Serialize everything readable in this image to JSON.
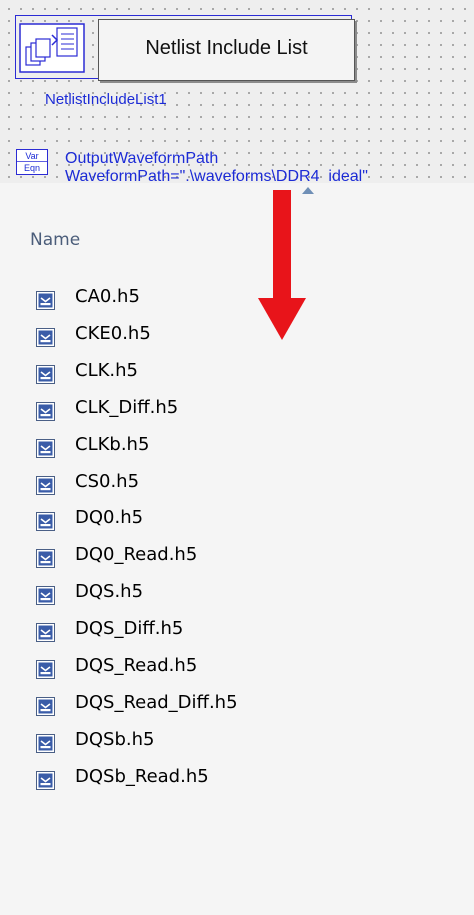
{
  "schematic": {
    "component": {
      "label": "Netlist Include List",
      "instance_name": "NetlistIncludeList1",
      "icon": "netlist-include-icon"
    },
    "var_eqn": {
      "icon_top": "Var",
      "icon_bottom": "Eqn",
      "name": "OutputWaveformPath",
      "expression": "WaveformPath=\".\\waveforms\\DDR4_ideal\""
    }
  },
  "annotation": {
    "arrow_color": "#e8141a",
    "icon": "down-arrow-icon"
  },
  "explorer": {
    "column_header": "Name",
    "sort_indicator_icon": "sort-ascending-icon",
    "files": [
      "CA0.h5",
      "CKE0.h5",
      "CLK.h5",
      "CLK_Diff.h5",
      "CLKb.h5",
      "CS0.h5",
      "DQ0.h5",
      "DQ0_Read.h5",
      "DQS.h5",
      "DQS_Diff.h5",
      "DQS_Read.h5",
      "DQS_Read_Diff.h5",
      "DQSb.h5",
      "DQSb_Read.h5"
    ]
  },
  "colors": {
    "schematic_text": "#1c2bd6",
    "component_border": "#2b2bd4",
    "header_text": "#4b5d7a"
  }
}
